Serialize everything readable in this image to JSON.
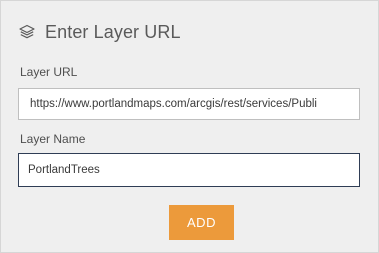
{
  "dialog": {
    "title": "Enter Layer URL",
    "title_icon": "layers-icon"
  },
  "layer_url": {
    "label": "Layer URL",
    "value": "https://www.portlandmaps.com/arcgis/rest/services/Publi"
  },
  "layer_name": {
    "label": "Layer Name",
    "value": "PortlandTrees"
  },
  "actions": {
    "add_label": "ADD"
  },
  "colors": {
    "panel_background": "#efefef",
    "button_accent": "#ec9a3b",
    "focused_border": "#2f3d55",
    "title_text": "#5a5a5a"
  }
}
